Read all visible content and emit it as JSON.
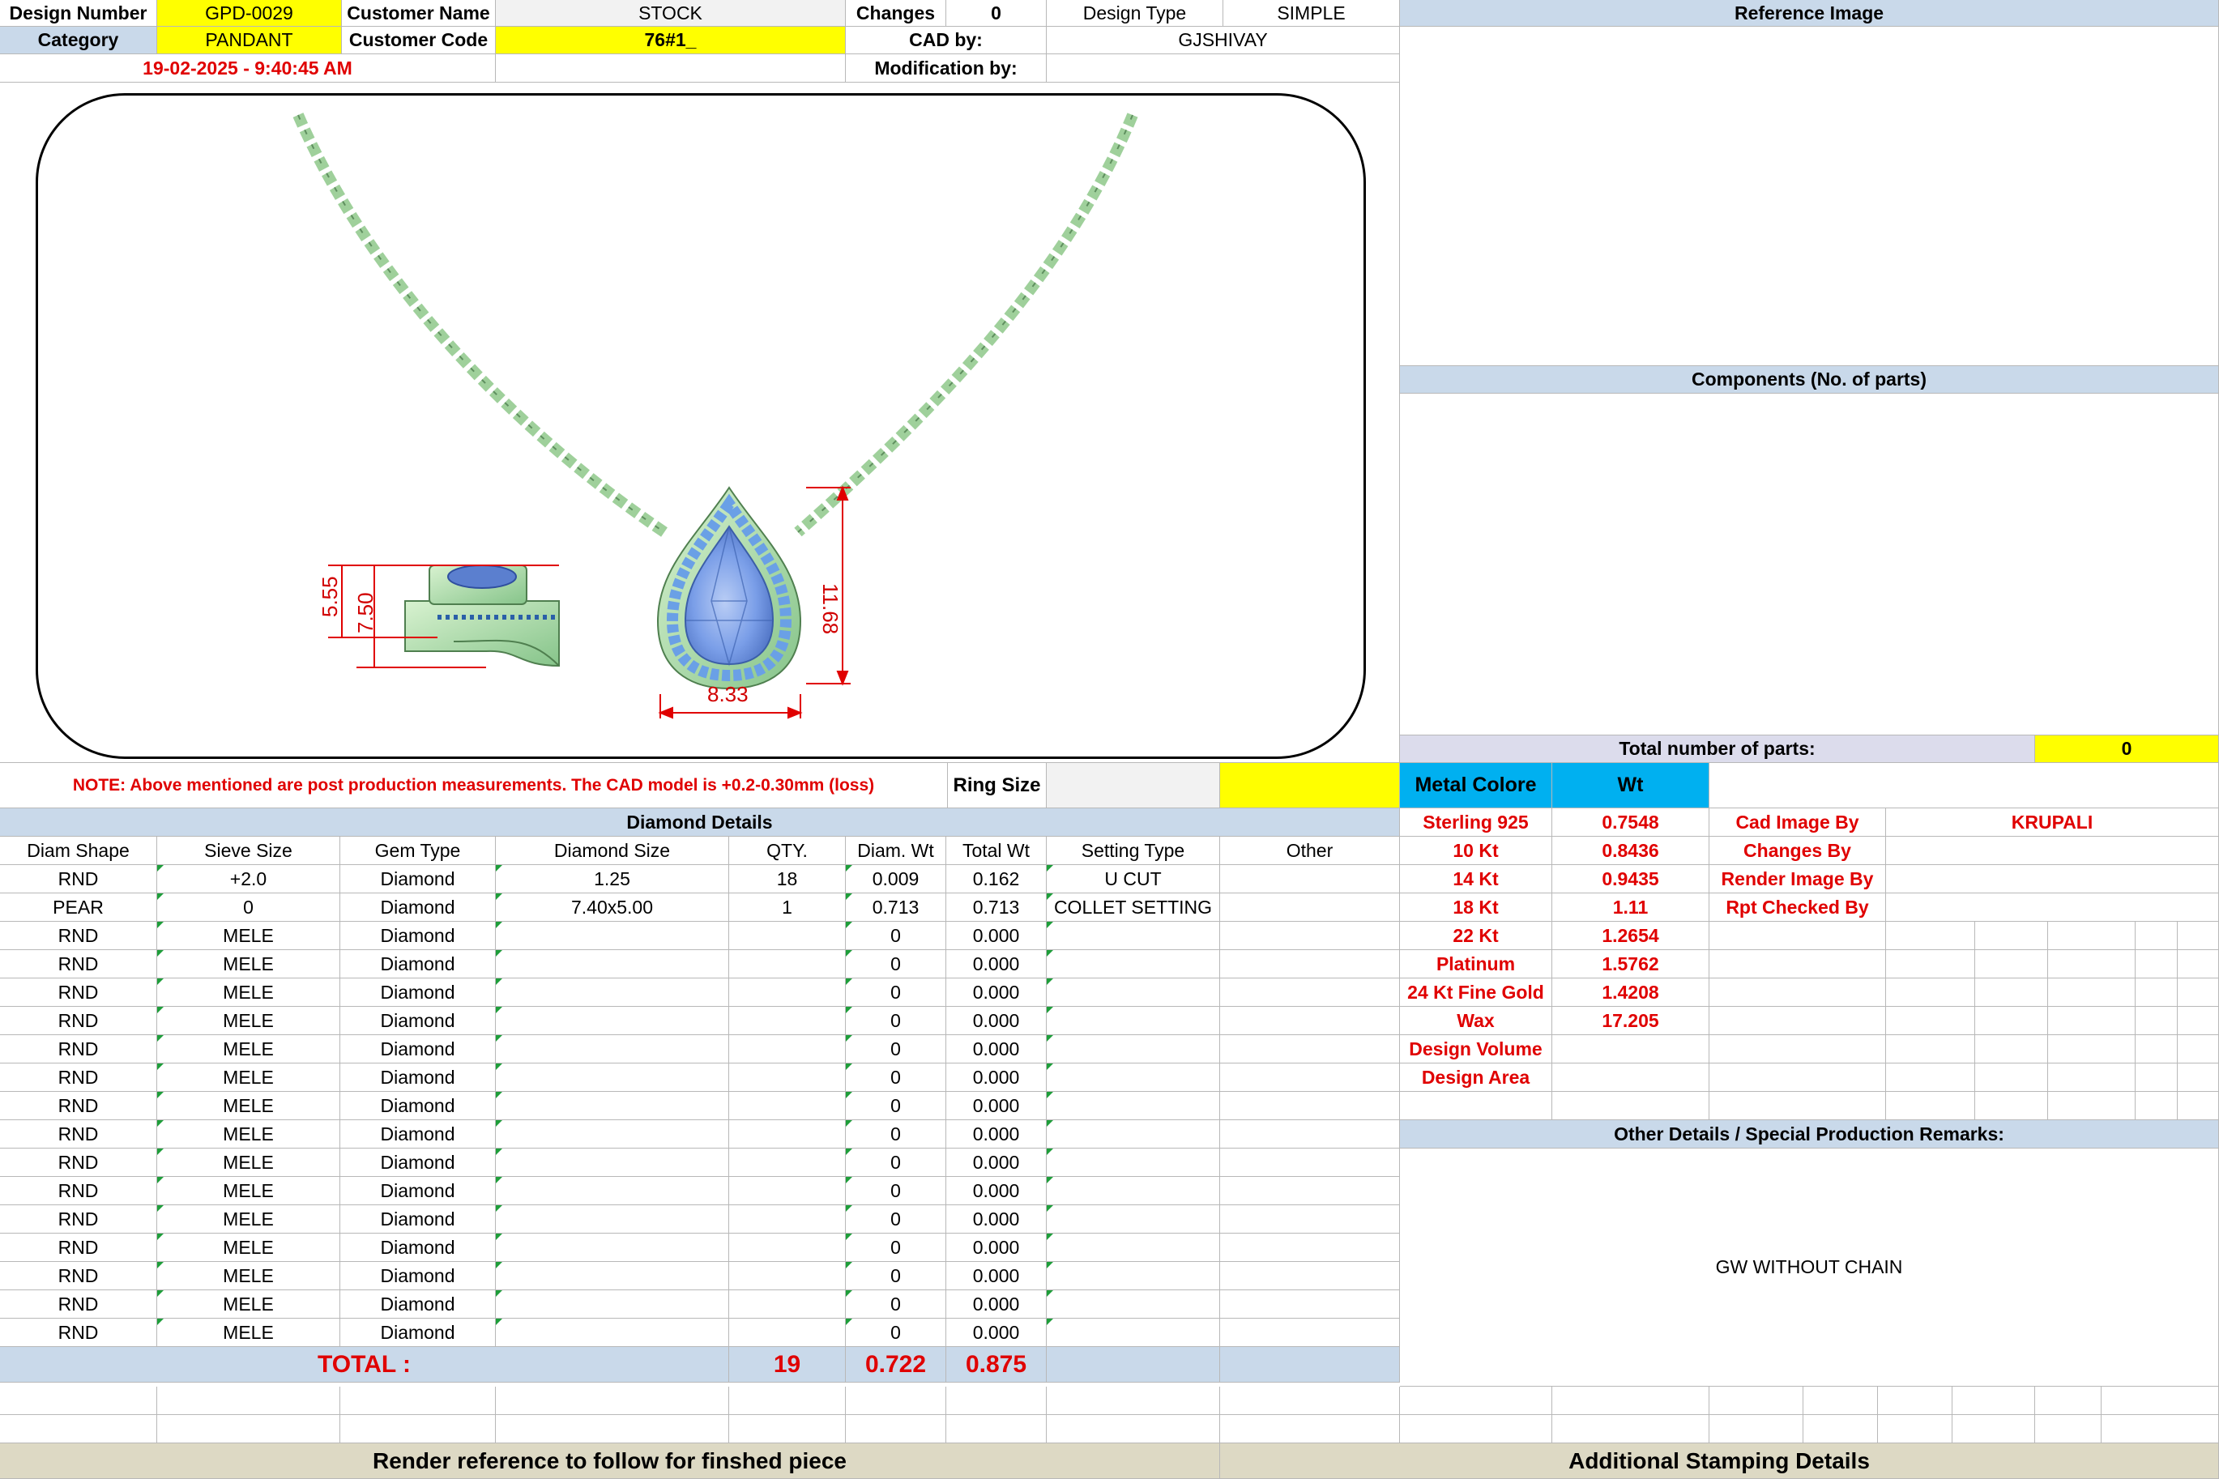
{
  "header": {
    "design_number_label": "Design Number",
    "design_number": "GPD-0029",
    "customer_name_label": "Customer Name",
    "customer_name": "STOCK",
    "changes_label": "Changes",
    "changes": "0",
    "design_type_label": "Design Type",
    "design_type": "SIMPLE",
    "category_label": "Category",
    "category": "PANDANT",
    "customer_code_label": "Customer Code",
    "customer_code": "76#1_",
    "cad_by_label": "CAD by:",
    "cad_by": "GJSHIVAY",
    "timestamp": "19-02-2025 - 9:40:45 AM",
    "modification_label": "Modification by:",
    "modification_by": ""
  },
  "reference": {
    "reference_image_label": "Reference Image",
    "components_label": "Components (No. of parts)",
    "total_parts_label": "Total number of parts:",
    "total_parts": "0"
  },
  "drawing": {
    "dim_width": "8.33",
    "dim_height": "11.68",
    "dim_side_inner": "5.55",
    "dim_side_outer": "7.50"
  },
  "note": "NOTE: Above mentioned are post production measurements. The CAD model is +0.2-0.30mm (loss)",
  "ring_size_label": "Ring Size",
  "ring_size": "",
  "diamond": {
    "title": "Diamond Details",
    "columns": [
      "Diam Shape",
      "Sieve Size",
      "Gem Type",
      "Diamond Size",
      "QTY.",
      "Diam. Wt",
      "Total Wt",
      "Setting Type",
      "Other"
    ],
    "rows": [
      [
        "RND",
        "+2.0",
        "Diamond",
        "1.25",
        "18",
        "0.009",
        "0.162",
        "U CUT",
        ""
      ],
      [
        "PEAR",
        "0",
        "Diamond",
        "7.40x5.00",
        "1",
        "0.713",
        "0.713",
        "COLLET SETTING",
        ""
      ],
      [
        "RND",
        "MELE",
        "Diamond",
        "",
        "",
        "0",
        "0.000",
        "",
        ""
      ],
      [
        "RND",
        "MELE",
        "Diamond",
        "",
        "",
        "0",
        "0.000",
        "",
        ""
      ],
      [
        "RND",
        "MELE",
        "Diamond",
        "",
        "",
        "0",
        "0.000",
        "",
        ""
      ],
      [
        "RND",
        "MELE",
        "Diamond",
        "",
        "",
        "0",
        "0.000",
        "",
        ""
      ],
      [
        "RND",
        "MELE",
        "Diamond",
        "",
        "",
        "0",
        "0.000",
        "",
        ""
      ],
      [
        "RND",
        "MELE",
        "Diamond",
        "",
        "",
        "0",
        "0.000",
        "",
        ""
      ],
      [
        "RND",
        "MELE",
        "Diamond",
        "",
        "",
        "0",
        "0.000",
        "",
        ""
      ],
      [
        "RND",
        "MELE",
        "Diamond",
        "",
        "",
        "0",
        "0.000",
        "",
        ""
      ],
      [
        "RND",
        "MELE",
        "Diamond",
        "",
        "",
        "0",
        "0.000",
        "",
        ""
      ],
      [
        "RND",
        "MELE",
        "Diamond",
        "",
        "",
        "0",
        "0.000",
        "",
        ""
      ],
      [
        "RND",
        "MELE",
        "Diamond",
        "",
        "",
        "0",
        "0.000",
        "",
        ""
      ],
      [
        "RND",
        "MELE",
        "Diamond",
        "",
        "",
        "0",
        "0.000",
        "",
        ""
      ],
      [
        "RND",
        "MELE",
        "Diamond",
        "",
        "",
        "0",
        "0.000",
        "",
        ""
      ],
      [
        "RND",
        "MELE",
        "Diamond",
        "",
        "",
        "0",
        "0.000",
        "",
        ""
      ],
      [
        "RND",
        "MELE",
        "Diamond",
        "",
        "",
        "0",
        "0.000",
        "",
        ""
      ]
    ],
    "total_label": "TOTAL :",
    "total_qty": "19",
    "total_diam_wt": "0.722",
    "total_wt": "0.875"
  },
  "metal": {
    "color_label": "Metal Colore",
    "wt_label": "Wt",
    "rows": [
      [
        "Sterling 925",
        "0.7548"
      ],
      [
        "10 Kt",
        "0.8436"
      ],
      [
        "14 Kt",
        "0.9435"
      ],
      [
        "18 Kt",
        "1.11"
      ],
      [
        "22 Kt",
        "1.2654"
      ],
      [
        "Platinum",
        "1.5762"
      ],
      [
        "24 Kt Fine Gold",
        "1.4208"
      ],
      [
        "Wax",
        "17.205"
      ],
      [
        "Design Volume",
        ""
      ],
      [
        "Design Area",
        ""
      ]
    ]
  },
  "credits": {
    "rows": [
      [
        "Cad Image By",
        "KRUPALI"
      ],
      [
        "Changes By",
        ""
      ],
      [
        "Render Image By",
        ""
      ],
      [
        "Rpt Checked By",
        ""
      ]
    ]
  },
  "remarks": {
    "title": "Other Details / Special Production Remarks:",
    "text": "GW WITHOUT CHAIN"
  },
  "footer": {
    "render_reference": "Render reference to follow for finshed piece",
    "stamping": "Additional Stamping Details"
  },
  "colors": {
    "yellow": "#ffff00",
    "header_blue": "#c9d9ea",
    "metal_blue": "#00b0f0",
    "footer_tan": "#ddd9c4",
    "red_text": "#e00000",
    "metal_green": "#a8dca8",
    "gem_blue": "#7a9ee8"
  }
}
